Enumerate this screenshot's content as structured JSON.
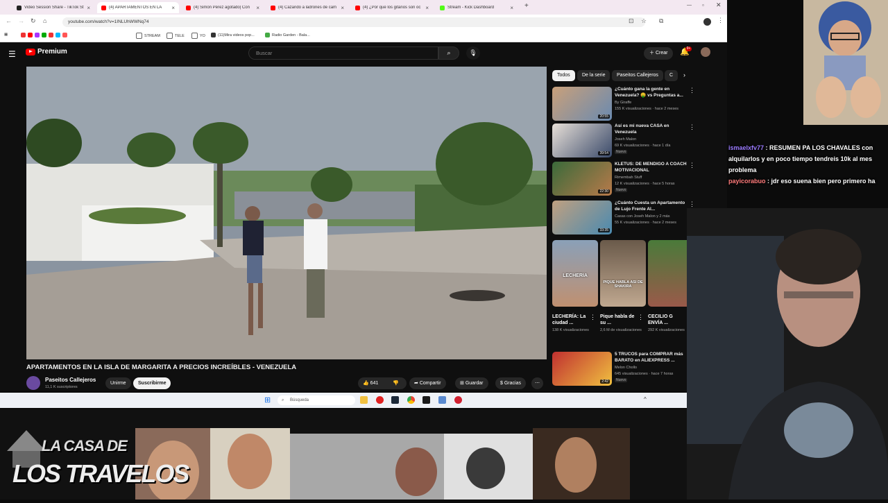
{
  "browser": {
    "tabs": [
      {
        "label": "Video Session Share - TikTok St",
        "color": "#222222"
      },
      {
        "label": "(4) APARTAMENTOS EN LA",
        "color": "#ff0000",
        "active": true
      },
      {
        "label": "(4) Simón Pérez agotado| Con",
        "color": "#ff0000"
      },
      {
        "label": "(4) Cazando a ladrones de cam",
        "color": "#ff0000"
      },
      {
        "label": "(4) ¿Por qué los gitanos son oc",
        "color": "#ff0000"
      },
      {
        "label": "Stream - Kick Dashboard",
        "color": "#53fc18"
      }
    ],
    "url": "youtube.com/watch?v=1INLUhWWNq74",
    "bookmarks": [
      "STREAM",
      "TELE",
      "YO",
      "(11)Mira videos pop...",
      "Radio Garden - Bala..."
    ]
  },
  "youtube": {
    "logo_text": "Premium",
    "search_placeholder": "Buscar",
    "create_label": "Crear",
    "notif_count": "9+",
    "video_title": "APARTAMENTOS EN LA ISLA DE MARGARITA A PRECIOS INCREÍBLES - VENEZUELA",
    "channel_name": "Paseitos Callejeros",
    "channel_subs": "11,1 K suscriptores",
    "join_label": "Unirme",
    "subscribe_label": "Suscribirme",
    "likes": "641",
    "share_label": "Compartir",
    "save_label": "Guardar",
    "thanks_label": "Gracias",
    "chips": [
      "Todos",
      "De la serie",
      "Paseitos Callejeros",
      "C"
    ],
    "recommendations": [
      {
        "title": "¿Cuánto gana la gente en Venezuela? 🤑 vs Preguntas a...",
        "channel": "By Giraffe",
        "meta": "155 K visualizaciones · hace 2 meses",
        "duration": "20:55",
        "badge": ""
      },
      {
        "title": "Así es mi nueva CASA en Venezuela",
        "channel": "Joseh Malon",
        "meta": "69 K visualizaciones · hace 1 día",
        "duration": "39:54",
        "badge": "Nuevo"
      },
      {
        "title": "KLETUS: DE MENDIGO A COACH MOTIVACIONAL",
        "channel": "Rimembah Stuff",
        "meta": "12 K visualizaciones · hace 5 horas",
        "duration": "22:30",
        "badge": "Nuevo"
      },
      {
        "title": "¿Cuánto Cuesta un Apartamento de Lujo Frente Al...",
        "channel": "Casas con Joseh Malon y 2 más",
        "meta": "55 K visualizaciones · hace 2 meses",
        "duration": "33:35",
        "badge": ""
      }
    ],
    "shorts": [
      {
        "title": "LECHERÍA: La ciudad ...",
        "views": "138 K visualizaciones",
        "thumb_text": "LECHERIA"
      },
      {
        "title": "Pique habla de su ...",
        "views": "2,6 M de visualizaciones",
        "thumb_text": "PIQUE HABLA ASI DE SHAKIRA"
      },
      {
        "title": "CECILIO G ENVÍA ...",
        "views": "292 K visualizaciones",
        "thumb_text": ""
      }
    ],
    "last_rec": {
      "title": "5 TRUCOS para COMPRAR más BARATO en ALIEXPRESS ...",
      "channel": "Melon Chollo",
      "meta": "645 visualizaciones · hace 7 horas",
      "duration": "2:42",
      "badge": "Nuevo"
    }
  },
  "taskbar": {
    "search_placeholder": "Búsqueda"
  },
  "chat": [
    {
      "user": "ismaelxfv77",
      "message": "RESUMEN PA LOS CHAVALES con alquilarlos y en poco tiempo tendreis 10k al mes problema"
    },
    {
      "user": "payicorabuo",
      "message": "jdr eso suena bien pero primero ha"
    }
  ],
  "overlay": {
    "logo_line1": "LA CASA DE",
    "logo_line2": "LOS TRAVELOS"
  },
  "colors": {
    "yt_red": "#ff0000",
    "chat_user1": "#9b7bff",
    "chat_user2": "#ff7b7b"
  }
}
